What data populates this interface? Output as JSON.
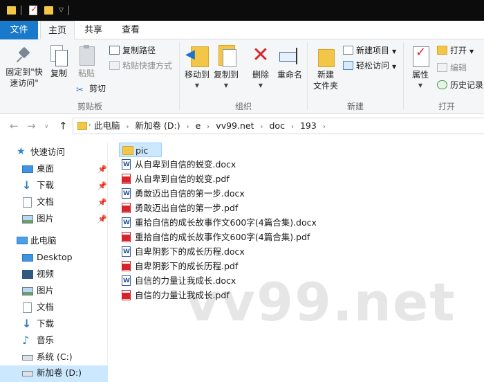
{
  "ribbon_tabs": {
    "file": "文件",
    "home": "主页",
    "share": "共享",
    "view": "查看"
  },
  "ribbon": {
    "clipboard": {
      "pin": "固定到\"快速访问\"",
      "copy": "复制",
      "paste": "粘贴",
      "copy_path": "复制路径",
      "paste_shortcut": "粘贴快捷方式",
      "cut": "剪切",
      "group": "剪贴板"
    },
    "organize": {
      "move_to": "移动到",
      "copy_to": "复制到",
      "delete": "删除",
      "rename": "重命名",
      "group": "组织"
    },
    "new": {
      "new_folder": "新建\n文件夹",
      "new_item": "新建项目",
      "easy_access": "轻松访问",
      "group": "新建"
    },
    "open": {
      "properties": "属性",
      "open": "打开",
      "edit": "编辑",
      "history": "历史记录",
      "group": "打开"
    }
  },
  "address": {
    "crumbs": [
      "此电脑",
      "新加卷 (D:)",
      "e",
      "vv99.net",
      "doc",
      "193"
    ]
  },
  "sidebar": {
    "quick_access": "快速访问",
    "quick_items": [
      "桌面",
      "下载",
      "文档",
      "图片"
    ],
    "this_pc": "此电脑",
    "pc_items": [
      "Desktop",
      "视频",
      "图片",
      "文档",
      "下载",
      "音乐",
      "系统 (C:)",
      "新加卷 (D:)"
    ]
  },
  "files": [
    {
      "name": "pic",
      "type": "folder"
    },
    {
      "name": "从自卑到自信的蜕变.docx",
      "type": "docx"
    },
    {
      "name": "从自卑到自信的蜕变.pdf",
      "type": "pdf"
    },
    {
      "name": "勇敢迈出自信的第一步.docx",
      "type": "docx"
    },
    {
      "name": "勇敢迈出自信的第一步.pdf",
      "type": "pdf"
    },
    {
      "name": "重拾自信的成长故事作文600字(4篇合集).docx",
      "type": "docx"
    },
    {
      "name": "重拾自信的成长故事作文600字(4篇合集).pdf",
      "type": "pdf"
    },
    {
      "name": "自卑阴影下的成长历程.docx",
      "type": "docx"
    },
    {
      "name": "自卑阴影下的成长历程.pdf",
      "type": "pdf"
    },
    {
      "name": "自信的力量让我成长.docx",
      "type": "docx"
    },
    {
      "name": "自信的力量让我成长.pdf",
      "type": "pdf"
    }
  ],
  "watermark": "vv99.net"
}
